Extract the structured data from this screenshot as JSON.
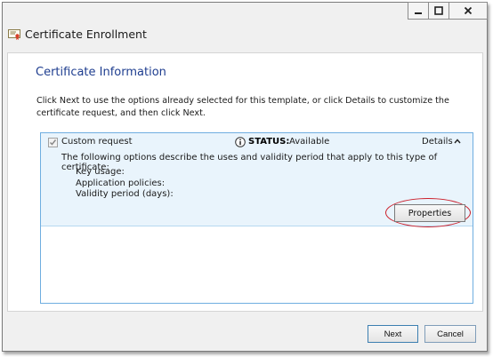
{
  "window": {
    "title": "Certificate Enrollment",
    "controls": {
      "minimize": "minimize",
      "maximize": "maximize",
      "close": "close"
    }
  },
  "page": {
    "heading": "Certificate Information",
    "intro": "Click Next to use the options already selected for this template, or click Details to customize the certificate request, and then click Next."
  },
  "request": {
    "checked": true,
    "label": "Custom request",
    "status_label": "STATUS:",
    "status_value": "Available",
    "details_label": "Details",
    "description": "The following options describe the uses and validity period that apply to this type of certificate:",
    "fields": [
      "Key usage:",
      "Application policies:",
      "Validity period (days):"
    ],
    "properties_button": "Properties"
  },
  "footer": {
    "next_label": "Next",
    "cancel_label": "Cancel"
  },
  "colors": {
    "heading": "#1e3d8f",
    "panel_border": "#6faee0",
    "panel_fill": "#e9f4fc",
    "highlight_ring": "#cc1f2a"
  }
}
